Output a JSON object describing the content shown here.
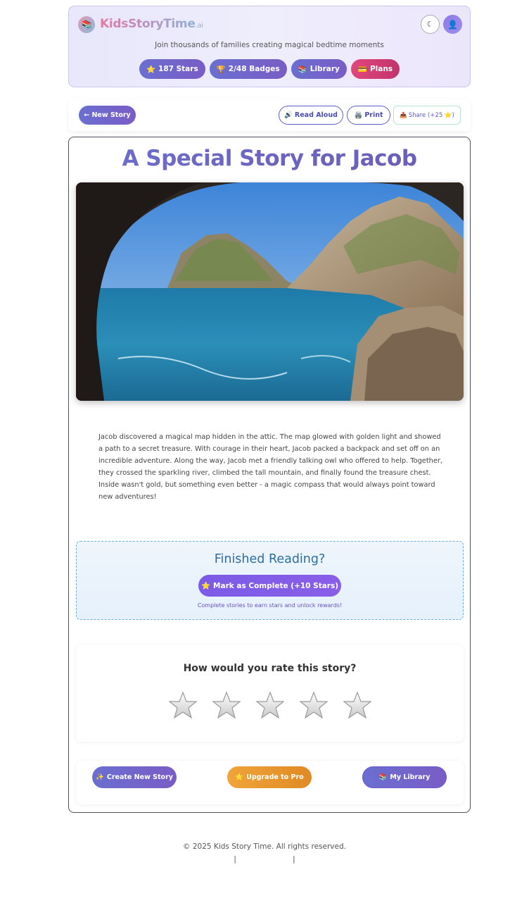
{
  "header": {
    "logo_icon": "📚",
    "brand": "KidsStoryTime",
    "brand_suffix": ".ai",
    "theme_icon": "☾",
    "avatar_icon": "👤",
    "tagline": "Join thousands of families creating magical bedtime moments",
    "pills": [
      {
        "icon": "⭐",
        "label": "187 Stars"
      },
      {
        "icon": "🏆",
        "label": "2/48 Badges"
      },
      {
        "icon": "📚",
        "label": "Library"
      },
      {
        "icon": "💳",
        "label": "Plans"
      }
    ]
  },
  "toolbar": {
    "new_story": "← New Story",
    "read_aloud_icon": "🔊",
    "read_aloud": "Read Aloud",
    "print_icon": "🖨️",
    "print": "Print",
    "share_icon": "📤",
    "share": "Share (+25 ⭐)"
  },
  "story": {
    "title": "A Special Story for Jacob",
    "text": "Jacob discovered a magical map hidden in the attic. The map glowed with golden light and showed a path to a secret treasure. With courage in their heart, Jacob packed a backpack and set off on an incredible adventure. Along the way, Jacob met a friendly talking owl who offered to help. Together, they crossed the sparkling river, climbed the tall mountain, and finally found the treasure chest. Inside wasn't gold, but something even better - a magic compass that would always point toward new adventures!"
  },
  "finish": {
    "title": "Finished Reading?",
    "button_icon": "⭐",
    "button": "Mark as Complete (+10 Stars)",
    "hint": "Complete stories to earn stars and unlock rewards!"
  },
  "rating": {
    "title": "How would you rate this story?",
    "max_stars": 5,
    "selected": 0
  },
  "actions": {
    "create_icon": "✨",
    "create": "Create New Story",
    "upgrade_icon": "⭐",
    "upgrade": "Upgrade to Pro",
    "library_icon": "📚",
    "library": "My Library"
  },
  "footer": {
    "copyright": "© 2025 Kids Story Time. All rights reserved.",
    "separator": "|"
  }
}
